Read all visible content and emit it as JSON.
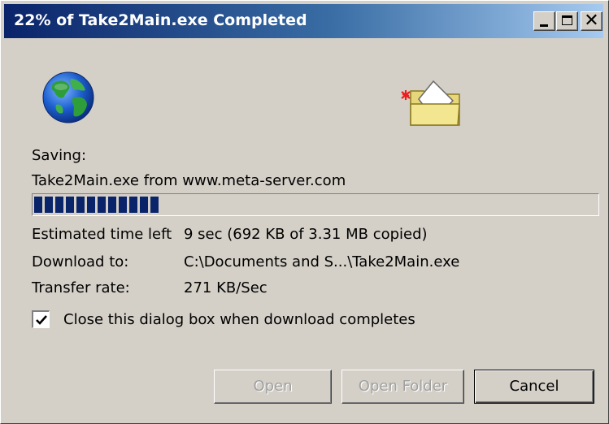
{
  "window": {
    "title": "22% of Take2Main.exe Completed",
    "controls": {
      "minimize_icon": "minimize-icon",
      "maximize_icon": "maximize-icon",
      "close_glyph": "✕"
    }
  },
  "icons": {
    "globe": "globe-icon",
    "folder": "folder-icon"
  },
  "status": {
    "saving_label": "Saving:",
    "file_line": "Take2Main.exe from www.meta-server.com",
    "progress_percent": 22
  },
  "details": {
    "time_left_label": "Estimated time left",
    "time_left_value": "9 sec (692 KB of 3.31 MB copied)",
    "download_to_label": "Download to:",
    "download_to_value": "C:\\Documents and S...\\Take2Main.exe",
    "transfer_rate_label": "Transfer rate:",
    "transfer_rate_value": "271 KB/Sec"
  },
  "options": {
    "close_on_complete_label": "Close this dialog box when download completes",
    "close_on_complete_checked": true
  },
  "buttons": {
    "open": "Open",
    "open_folder": "Open Folder",
    "cancel": "Cancel"
  },
  "colors": {
    "titlebar_start": "#0a246a",
    "titlebar_end": "#a6caf0",
    "progress_fill": "#0a246a",
    "dialog_bg": "#d4d0c8"
  }
}
